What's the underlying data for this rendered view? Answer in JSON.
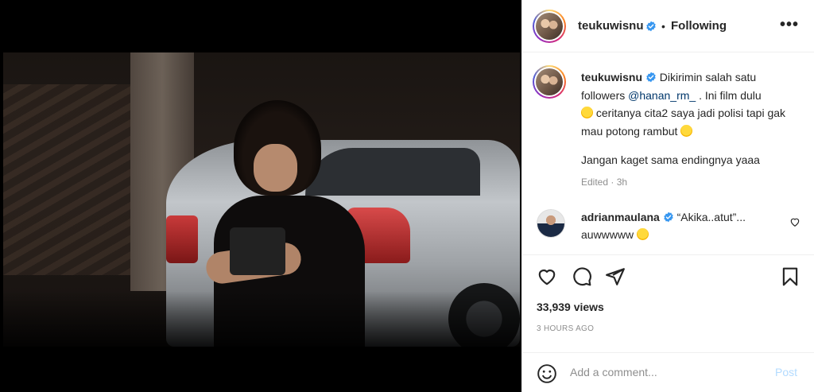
{
  "post": {
    "username": "teukuwisnu",
    "following_label": "Following",
    "separator": "•",
    "more_label": "•••",
    "caption_lines": {
      "part1": "Dikirimin salah satu followers ",
      "mention": "@hanan_rm_",
      "part2": " . Ini film dulu ",
      "part3": " ceritanya cita2 saya jadi polisi tapi gak mau potong rambut ",
      "part4": "Jangan kaget sama endingnya yaaa"
    },
    "edited": "Edited · 3h",
    "views": "33,939 views",
    "time": "3 HOURS AGO"
  },
  "comment": {
    "username": "adrianmaulana",
    "text_part1": " “Akika..atut”... auwwwww "
  },
  "composer": {
    "placeholder": "Add a comment...",
    "post_label": "Post"
  },
  "icons": {
    "verified": "verified-badge-icon",
    "like": "heart-icon",
    "comment": "comment-icon",
    "share": "send-icon",
    "save": "bookmark-icon",
    "emoji": "smiley-icon"
  },
  "colors": {
    "verified": "#3897f0",
    "mention": "#00376b",
    "post_disabled": "#b3dbff",
    "muted": "#8e8e8e"
  }
}
